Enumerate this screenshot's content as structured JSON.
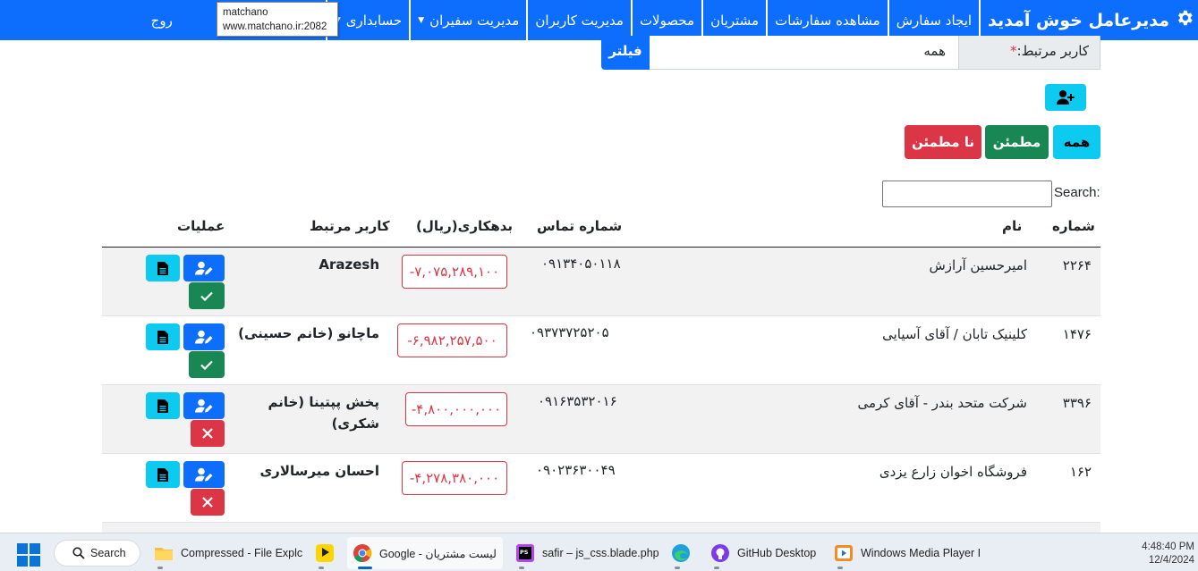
{
  "navbar": {
    "brand": "مدیرعامل خوش آمدید",
    "items": [
      "ایجاد سفارش",
      "مشاهده سفارشات",
      "مشتریان",
      "محصولات",
      "مدیریت کاربران",
      "مدیریت سفیران",
      "حسابداری"
    ],
    "exit_label": "روج",
    "brand_icon": "gear-icon",
    "color": "#0d6efd"
  },
  "tooltip": {
    "title": "matchano",
    "url": "www.matchano.ir:2082"
  },
  "filter": {
    "label": "کاربر مرتبط:",
    "required_mark": "*",
    "value": "همه",
    "button": "فیلتر"
  },
  "segments": {
    "all": "همه",
    "trusted": "مطمئن",
    "untrusted": "نا مطمئن"
  },
  "search": {
    "label": "Search:",
    "value": ""
  },
  "table": {
    "headers": {
      "number": "شماره",
      "name": "نام",
      "phone": "شماره تماس",
      "debt": "بدهکاری(ریال)",
      "user": "کاربر مرتبط",
      "ops": "عملیات"
    },
    "rows": [
      {
        "number": "۲۲۶۴",
        "name": "امیرحسین آرازش",
        "phone": "۰۹۱۳۴۰۵۰۱۱۸",
        "debt": "-۷,۰۷۵,۲۸۹,۱۰۰",
        "user": "Arazesh",
        "status": "trusted"
      },
      {
        "number": "۱۴۷۶",
        "name": "کلینیک تابان / آقای آسیایی",
        "phone": "۰۹۳۷۳۷۲۵۲۰۵",
        "debt": "-۶,۹۸۲,۲۵۷,۵۰۰",
        "user": "ماچانو (خانم حسینی)",
        "status": "trusted"
      },
      {
        "number": "۳۳۹۶",
        "name": "شرکت متحد بندر - آقای کرمی",
        "phone": "۰۹۱۶۳۵۳۲۰۱۶",
        "debt": "-۴,۸۰۰,۰۰۰,۰۰۰",
        "user": "پخش پپتینا (خانم شکری)",
        "status": "untrusted"
      },
      {
        "number": "۱۶۲",
        "name": "فروشگاه اخوان زارع یزدی",
        "phone": "۰۹۰۲۳۶۳۰۰۴۹",
        "debt": "-۴,۲۷۸,۳۸۰,۰۰۰",
        "user": "احسان میرسالاری",
        "status": "untrusted"
      }
    ]
  },
  "taskbar": {
    "search": "Search",
    "apps": [
      {
        "label": "Compressed - File Explc",
        "icon": "folder-icon"
      },
      {
        "label": "",
        "icon": "kmplayer-icon"
      },
      {
        "label": "Google - لیست مشتریان",
        "icon": "chrome-icon"
      },
      {
        "label": "safir – js_css.blade.php",
        "icon": "phpstorm-icon"
      },
      {
        "label": "",
        "icon": "edge-icon"
      },
      {
        "label": "GitHub Desktop",
        "icon": "github-icon"
      },
      {
        "label": "Windows Media Player I",
        "icon": "media-player-icon"
      }
    ],
    "time": "4:48:40 PM",
    "date": "12/4/2024"
  }
}
